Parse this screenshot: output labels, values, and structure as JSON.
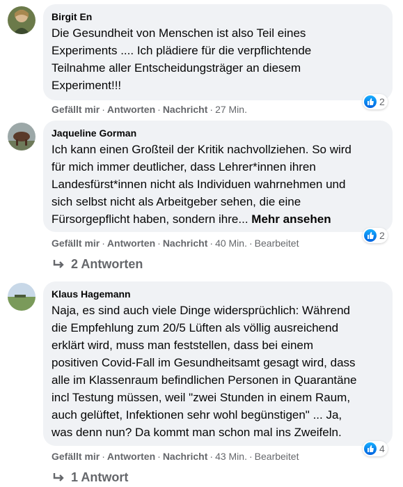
{
  "comments": [
    {
      "author": "Birgit En",
      "lines": [
        "Die Gesundheit von Menschen ist also Teil eines",
        "Experiments .... Ich plädiere für die verpflichtende",
        "Teilnahme aller Entscheidungsträger an diesem",
        "Experiment!!!"
      ],
      "reaction_count": "2",
      "like": "Gefällt mir",
      "reply": "Antworten",
      "message": "Nachricht",
      "time": "27 Min."
    },
    {
      "author": "Jaqueline Gorman",
      "lines": [
        "Ich kann einen Großteil der Kritik nachvollziehen. So wird",
        "für mich immer deutlicher, dass Lehrer*innen ihren",
        "Landesfürst*innen nicht als Individuen wahrnehmen und",
        "sich selbst nicht als Arbeitgeber sehen, die eine",
        "Fürsorgepflicht haben, sondern ihre..."
      ],
      "more": "Mehr ansehen",
      "reaction_count": "2",
      "like": "Gefällt mir",
      "reply": "Antworten",
      "message": "Nachricht",
      "time": "40 Min.",
      "edited": "Bearbeitet",
      "replies": "2 Antworten"
    },
    {
      "author": "Klaus Hagemann",
      "lines": [
        "Naja, es sind auch viele Dinge widersprüchlich: Während",
        "die Empfehlung zum 20/5 Lüften als völlig ausreichend",
        "erklärt wird, muss man feststellen, dass bei einem",
        "positiven Covid-Fall im Gesundheitsamt gesagt wird, dass",
        "alle im Klassenraum befindlichen Personen in Quarantäne",
        "incl Testung müssen, weil \"zwei Stunden in einem Raum,",
        "auch gelüftet, Infektionen sehr wohl begünstigen\" ... Ja,",
        "was denn nun? Da kommt man schon mal ins Zweifeln."
      ],
      "reaction_count": "4",
      "like": "Gefällt mir",
      "reply": "Antworten",
      "message": "Nachricht",
      "time": "43 Min.",
      "edited": "Bearbeitet",
      "replies": "1 Antwort"
    }
  ],
  "separator": "·",
  "colors": {
    "bubble": "#f0f2f5",
    "meta": "#65676b",
    "like_blue": "#1877f2"
  },
  "icons": {
    "reaction": "like-thumb-icon",
    "reply_arrow": "reply-arrow-icon"
  }
}
